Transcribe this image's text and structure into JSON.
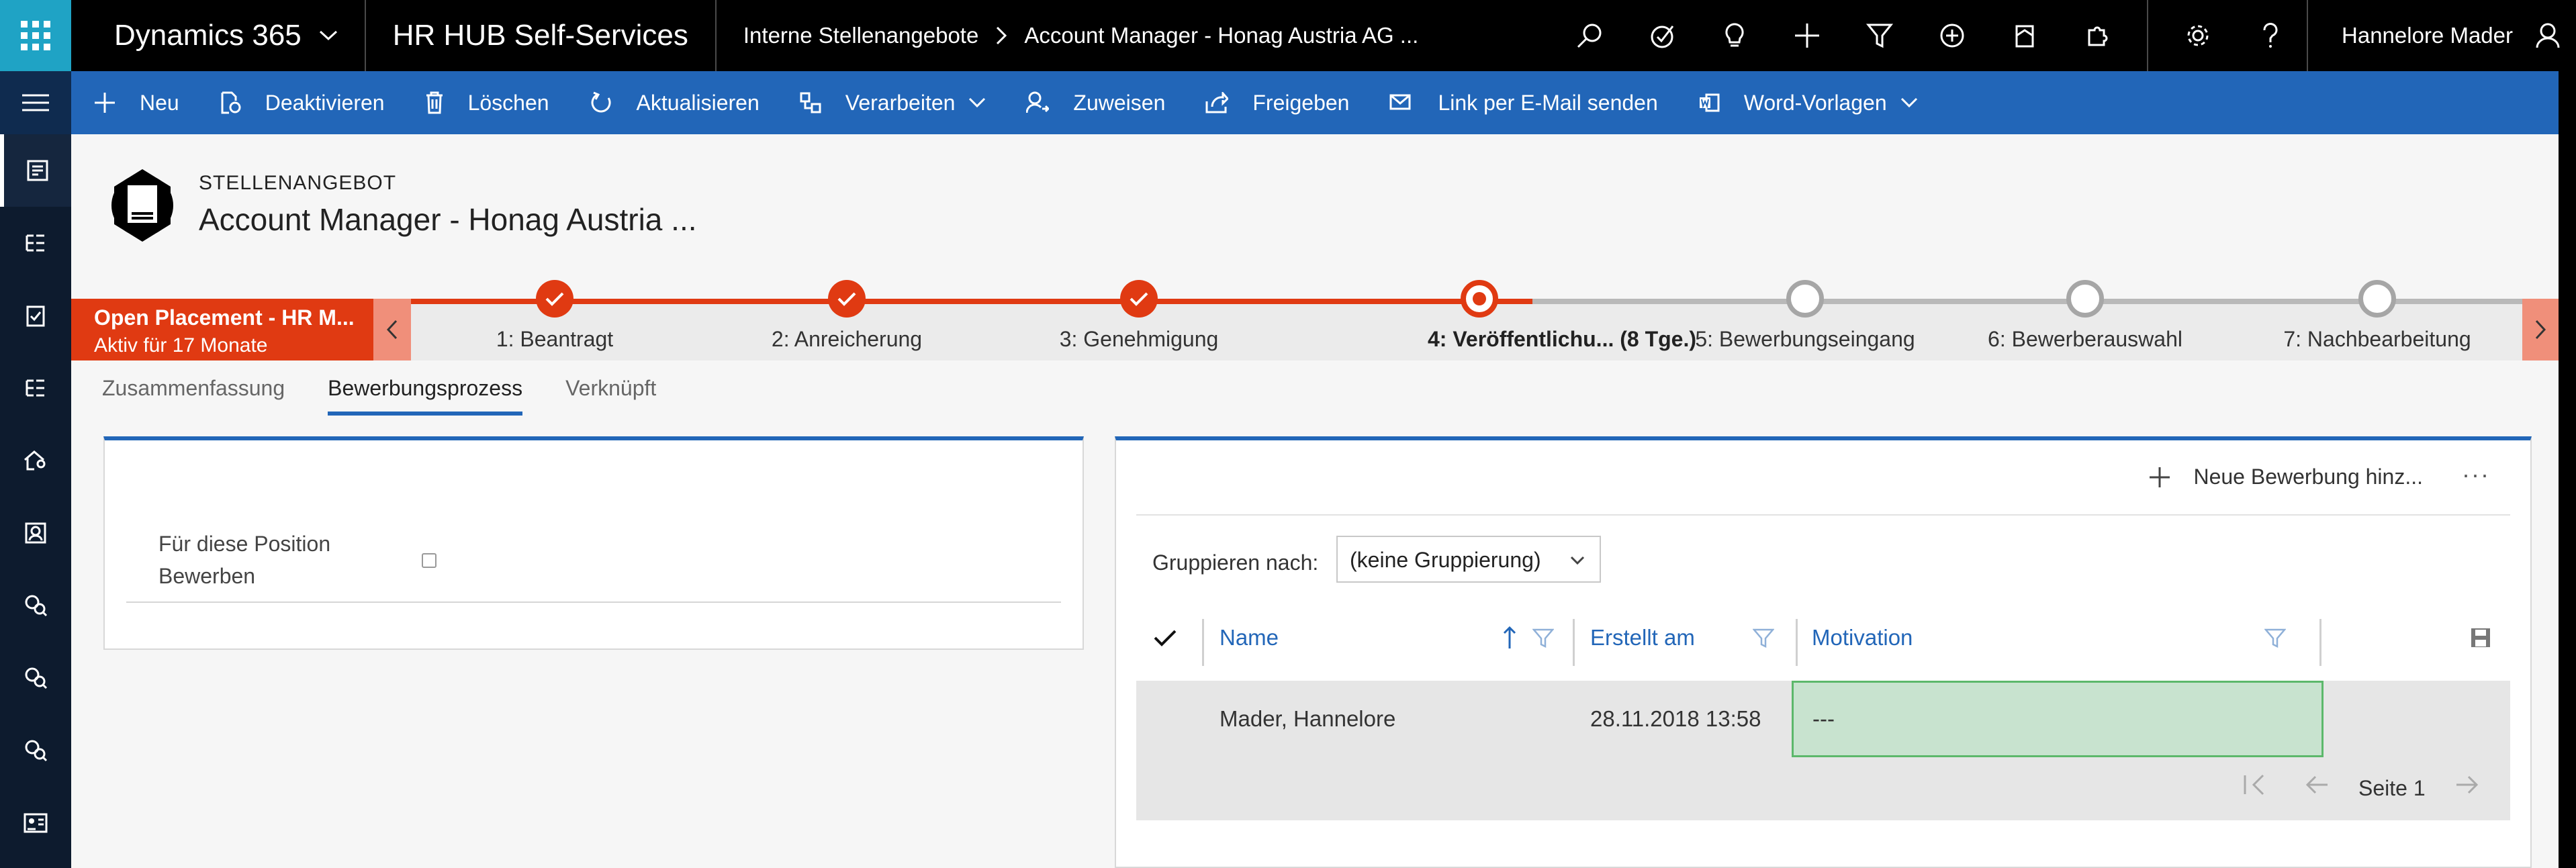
{
  "topbar": {
    "brand": "Dynamics 365",
    "app_name": "HR HUB Self-Services",
    "breadcrumb": [
      "Interne Stellenangebote",
      "Account Manager - Honag Austria AG ..."
    ],
    "user_name": "Hannelore Mader",
    "icons": [
      "search-icon",
      "task-icon",
      "idea-icon",
      "add-icon",
      "filter-icon",
      "circle-plus-icon",
      "clipboard-icon",
      "puzzle-icon",
      "gear-icon",
      "help-icon",
      "person-icon"
    ]
  },
  "commandbar": {
    "items": [
      {
        "label": "Neu",
        "icon": "plus-icon"
      },
      {
        "label": "Deaktivieren",
        "icon": "deactivate-icon"
      },
      {
        "label": "Löschen",
        "icon": "trash-icon"
      },
      {
        "label": "Aktualisieren",
        "icon": "refresh-icon"
      },
      {
        "label": "Verarbeiten",
        "icon": "process-icon",
        "dropdown": true
      },
      {
        "label": "Zuweisen",
        "icon": "assign-icon"
      },
      {
        "label": "Freigeben",
        "icon": "share-icon"
      },
      {
        "label": "Link per E-Mail senden",
        "icon": "email-link-icon"
      },
      {
        "label": "Word-Vorlagen",
        "icon": "word-icon",
        "dropdown": true
      }
    ]
  },
  "header": {
    "entity_type": "STELLENANGEBOT",
    "title": "Account Manager - Honag Austria ..."
  },
  "bpf": {
    "active_process": "Open Placement - HR M...",
    "active_duration": "Aktiv für 17 Monate",
    "stages": [
      {
        "label": "1: Beantragt",
        "state": "done"
      },
      {
        "label": "2: Anreicherung",
        "state": "done"
      },
      {
        "label": "3: Genehmigung",
        "state": "done"
      },
      {
        "label": "4: Veröffentlichu...   (8 Tge.)",
        "state": "current"
      },
      {
        "label": "5: Bewerbungseingang",
        "state": "todo"
      },
      {
        "label": "6: Bewerberauswahl",
        "state": "todo"
      },
      {
        "label": "7: Nachbearbeitung",
        "state": "todo"
      }
    ]
  },
  "tabs": [
    "Zusammenfassung",
    "Bewerbungsprozess",
    "Verknüpft"
  ],
  "active_tab": "Bewerbungsprozess",
  "left_section": {
    "field_label_line1": "Für diese Position",
    "field_label_line2": "Bewerben",
    "checked": false
  },
  "subgrid": {
    "add_button": "Neue Bewerbung hinz...",
    "more": "···",
    "group_label": "Gruppieren nach:",
    "group_value": "(keine Gruppierung)",
    "columns": [
      "Name",
      "Erstellt am",
      "Motivation"
    ],
    "rows": [
      {
        "name": "Mader, Hannelore",
        "created": "28.11.2018 13:58",
        "motivation": "---"
      }
    ],
    "page_label": "Seite 1"
  }
}
